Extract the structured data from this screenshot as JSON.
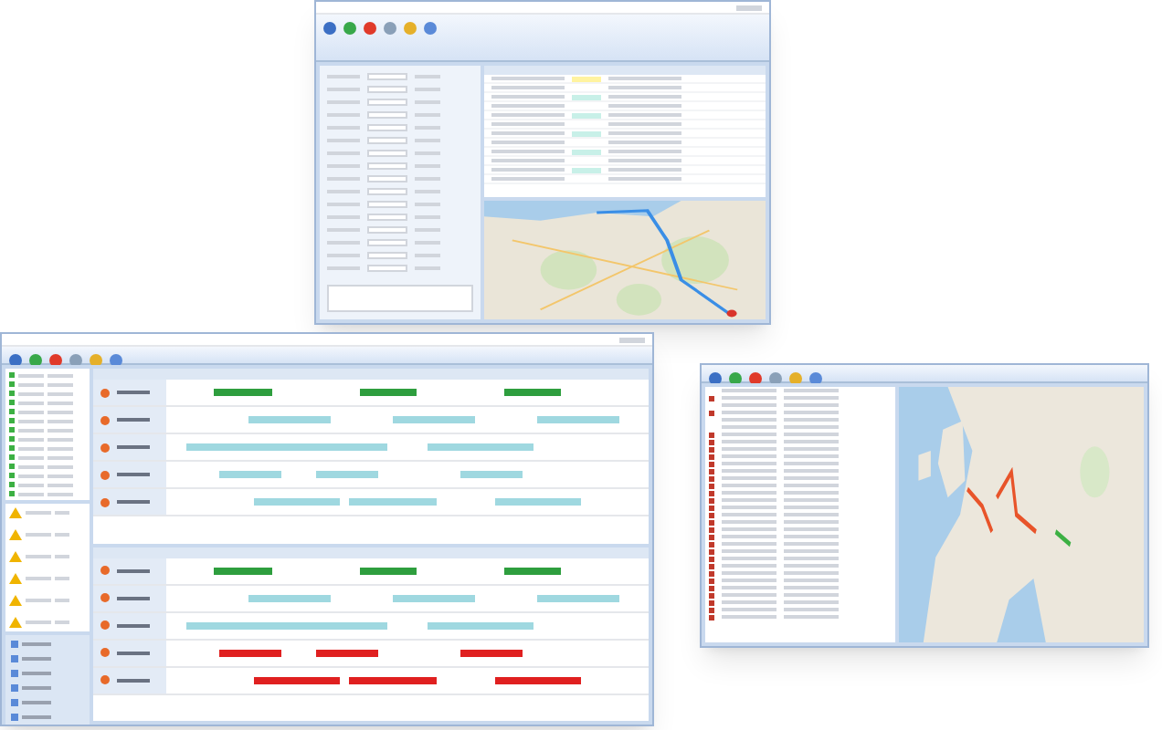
{
  "windows": [
    {
      "kind": "order-editor",
      "grid_rows": [
        {
          "kind": "tagged",
          "color": "#fff3a0"
        },
        {
          "kind": "plain"
        },
        {
          "kind": "tagged",
          "color": "#c8f0e8"
        },
        {
          "kind": "plain"
        },
        {
          "kind": "tagged",
          "color": "#c8f0e8"
        },
        {
          "kind": "plain"
        },
        {
          "kind": "tagged",
          "color": "#c8f0e8"
        },
        {
          "kind": "plain"
        },
        {
          "kind": "tagged",
          "color": "#c8f0e8"
        },
        {
          "kind": "plain"
        },
        {
          "kind": "tagged",
          "color": "#c8f0e8"
        },
        {
          "kind": "plain"
        }
      ]
    },
    {
      "kind": "planning-board",
      "sidebar_items": [
        {
          "color": "#3cb043"
        },
        {
          "color": "#3cb043"
        },
        {
          "color": "#3cb043"
        },
        {
          "color": "#3cb043"
        },
        {
          "color": "#3cb043"
        },
        {
          "color": "#3cb043"
        },
        {
          "color": "#3cb043"
        },
        {
          "color": "#3cb043"
        },
        {
          "color": "#3cb043"
        },
        {
          "color": "#3cb043"
        },
        {
          "color": "#3cb043"
        },
        {
          "color": "#3cb043"
        },
        {
          "color": "#3cb043"
        },
        {
          "color": "#3cb043"
        }
      ],
      "alerts": [
        {
          "kind": "warning"
        },
        {
          "kind": "warning"
        },
        {
          "kind": "warning"
        },
        {
          "kind": "warning"
        },
        {
          "kind": "warning"
        },
        {
          "kind": "warning"
        }
      ],
      "lanes_top": [
        {
          "color": "#2e9e3e"
        },
        {
          "color": "#9fd8e0"
        },
        {
          "color": "#9fd8e0"
        },
        {
          "color": "#9fd8e0"
        },
        {
          "color": "#9fd8e0"
        }
      ],
      "lanes_bottom": [
        {
          "color": "#2e9e3e"
        },
        {
          "color": "#9fd8e0"
        },
        {
          "color": "#9fd8e0"
        },
        {
          "color": "#e02020"
        },
        {
          "color": "#e02020"
        }
      ]
    },
    {
      "kind": "map-overview",
      "list_rows": [
        {
          "alert": false
        },
        {
          "alert": true
        },
        {
          "alert": false
        },
        {
          "alert": true
        },
        {
          "alert": false
        },
        {
          "alert": false
        },
        {
          "alert": true
        },
        {
          "alert": true
        },
        {
          "alert": true
        },
        {
          "alert": true
        },
        {
          "alert": true
        },
        {
          "alert": true
        },
        {
          "alert": true
        },
        {
          "alert": true
        },
        {
          "alert": true
        },
        {
          "alert": true
        },
        {
          "alert": true
        },
        {
          "alert": true
        },
        {
          "alert": true
        },
        {
          "alert": true
        },
        {
          "alert": true
        },
        {
          "alert": true
        },
        {
          "alert": true
        },
        {
          "alert": true
        },
        {
          "alert": true
        },
        {
          "alert": true
        },
        {
          "alert": true
        },
        {
          "alert": true
        },
        {
          "alert": true
        },
        {
          "alert": true
        },
        {
          "alert": true
        },
        {
          "alert": true
        }
      ]
    }
  ]
}
